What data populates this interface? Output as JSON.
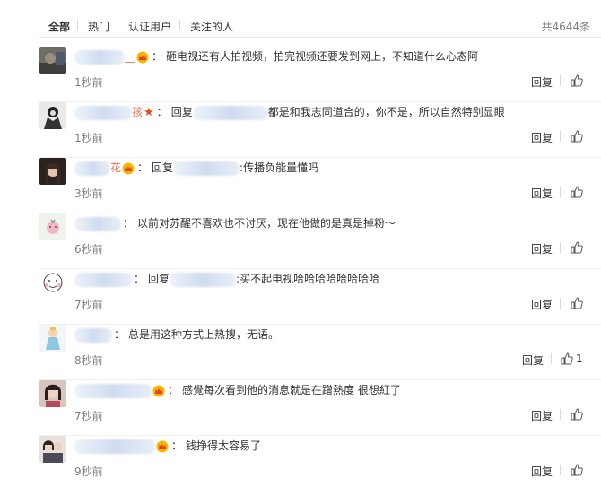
{
  "filter_tabs": [
    "全部",
    "热门",
    "认证用户",
    "关注的人"
  ],
  "total_label": "共4644条",
  "reply_label": "回复",
  "comments": [
    {
      "name_suffix": "__",
      "reply_prefix": "",
      "mention_suffix": "",
      "text": "砸电视还有人拍视频，拍完视频还要发到网上，不知道什么心态阿",
      "time": "1秒前",
      "likes": ""
    },
    {
      "name_suffix": "孩",
      "reply_prefix": "回复",
      "mention_suffix": "",
      "text": "都是和我志同道合的，你不是，所以自然特别显眼",
      "time": "1秒前",
      "likes": ""
    },
    {
      "name_suffix": "花",
      "reply_prefix": "回复",
      "mention_suffix": "",
      "text": ":传播负能量懂吗",
      "time": "3秒前",
      "likes": ""
    },
    {
      "name_suffix": "",
      "reply_prefix": "",
      "mention_suffix": "",
      "text": "以前对苏醒不喜欢也不讨厌，现在他做的是真是掉粉～",
      "time": "6秒前",
      "likes": ""
    },
    {
      "name_suffix": "",
      "reply_prefix": "回复",
      "mention_suffix": "",
      "text": ":买不起电视哈哈哈哈哈哈哈哈",
      "time": "7秒前",
      "likes": ""
    },
    {
      "name_suffix": "",
      "reply_prefix": "",
      "mention_suffix": "",
      "text": "总是用这种方式上热搜，无语。",
      "time": "8秒前",
      "likes": "1"
    },
    {
      "name_suffix": "",
      "reply_prefix": "",
      "mention_suffix": "",
      "text": "感覺每次看到他的消息就是在蹭熱度 很想紅了",
      "time": "7秒前",
      "likes": ""
    },
    {
      "name_suffix": "",
      "reply_prefix": "",
      "mention_suffix": "",
      "text": "钱挣得太容易了",
      "time": "9秒前",
      "likes": ""
    }
  ],
  "colors": {
    "accent": "#eb7350",
    "text": "#333333",
    "muted": "#808080"
  }
}
